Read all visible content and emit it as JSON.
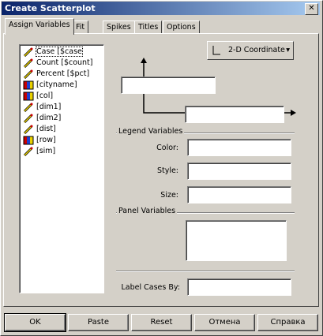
{
  "window": {
    "title": "Create Scatterplot",
    "close_symbol": "✕"
  },
  "tabs": [
    {
      "label": "Assign Variables"
    },
    {
      "label": "Fit"
    },
    {
      "label": "Spikes"
    },
    {
      "label": "Titles"
    },
    {
      "label": "Options"
    }
  ],
  "variables": [
    {
      "label": "Case [$case",
      "icon": "scale-variable-icon"
    },
    {
      "label": "Count [$count]",
      "icon": "scale-variable-icon"
    },
    {
      "label": "Percent [$pct]",
      "icon": "scale-variable-icon"
    },
    {
      "label": "[cityname]",
      "icon": "nominal-variable-icon"
    },
    {
      "label": "[col]",
      "icon": "nominal-variable-icon"
    },
    {
      "label": "[dim1]",
      "icon": "scale-variable-icon"
    },
    {
      "label": "[dim2]",
      "icon": "scale-variable-icon"
    },
    {
      "label": "[dist]",
      "icon": "scale-variable-icon"
    },
    {
      "label": "[row]",
      "icon": "nominal-variable-icon"
    },
    {
      "label": "[sim]",
      "icon": "scale-variable-icon"
    }
  ],
  "coordinate_dropdown": {
    "value": "2-D Coordinate",
    "arrow": "▾"
  },
  "legend": {
    "heading": "Legend Variables",
    "color_label": "Color:",
    "style_label": "Style:",
    "size_label": "Size:"
  },
  "panel": {
    "heading": "Panel Variables"
  },
  "label_cases": {
    "label": "Label Cases By:"
  },
  "buttons": {
    "ok": "OK",
    "paste": "Paste",
    "reset": "Reset",
    "cancel": "Отмена",
    "help": "Справка"
  },
  "colors": {
    "title_gradient_start": "#0a246a",
    "title_gradient_end": "#a6caf0",
    "face": "#d4d0c8"
  }
}
